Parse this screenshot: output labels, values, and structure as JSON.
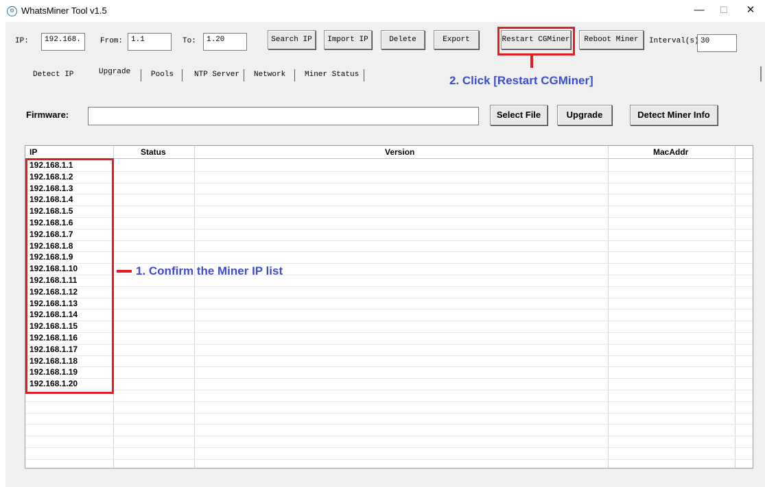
{
  "window": {
    "title": "WhatsMiner Tool v1.5",
    "app_icon": "whatsminer-logo-icon",
    "minimize_glyph": "—",
    "maximize_glyph": "☐",
    "close_glyph": "✕"
  },
  "toolbar": {
    "ip_label": "IP:",
    "ip_value": "192.168.",
    "from_label": "From:",
    "from_value": "1.1",
    "to_label": "To:",
    "to_value": "1.20",
    "search_ip": "Search IP",
    "import_ip": "Import IP",
    "delete": "Delete",
    "export": "Export",
    "restart_cgminer": "Restart CGMiner",
    "reboot_miner": "Reboot Miner",
    "interval_label": "Interval(s)",
    "interval_value": "30"
  },
  "tabs": [
    "Detect IP",
    "Upgrade",
    "Pools",
    "NTP Server",
    "Network",
    "Miner Status"
  ],
  "firmware": {
    "label": "Firmware:",
    "path_value": "",
    "select_file": "Select File",
    "upgrade": "Upgrade",
    "detect_miner_info": "Detect Miner Info"
  },
  "table": {
    "columns": [
      "IP",
      "Status",
      "Version",
      "MacAddr"
    ],
    "rows": [
      "192.168.1.1",
      "192.168.1.2",
      "192.168.1.3",
      "192.168.1.4",
      "192.168.1.5",
      "192.168.1.6",
      "192.168.1.7",
      "192.168.1.8",
      "192.168.1.9",
      "192.168.1.10",
      "192.168.1.11",
      "192.168.1.12",
      "192.168.1.13",
      "192.168.1.14",
      "192.168.1.15",
      "192.168.1.16",
      "192.168.1.17",
      "192.168.1.18",
      "192.168.1.19",
      "192.168.1.20"
    ]
  },
  "annotations": {
    "step1": "1. Confirm the Miner IP list",
    "step2": "2. Click [Restart CGMiner]",
    "highlight_color": "#e31b23",
    "note_color": "#3d4ccc"
  }
}
